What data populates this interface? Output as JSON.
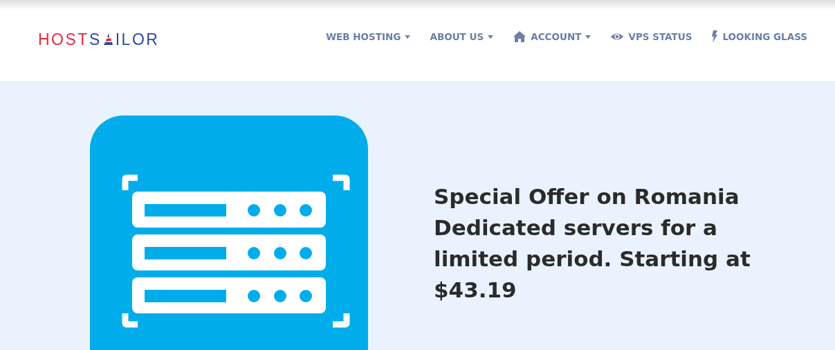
{
  "logo": {
    "part_1": "HOST",
    "part_2": "S",
    "part_3": "ILOR"
  },
  "nav": [
    {
      "label": "WEB HOSTING",
      "kind": "plain",
      "dropdown": true
    },
    {
      "label": "ABOUT US",
      "kind": "plain",
      "dropdown": true
    },
    {
      "label": "ACCOUNT",
      "kind": "home",
      "dropdown": true
    },
    {
      "label": "VPS STATUS",
      "kind": "eye",
      "dropdown": false
    },
    {
      "label": "LOOKING GLASS",
      "kind": "bolt",
      "dropdown": false
    }
  ],
  "hero": {
    "headline": "Special Offer on Romania Dedicated servers for a limited period. Starting at $43.19"
  }
}
